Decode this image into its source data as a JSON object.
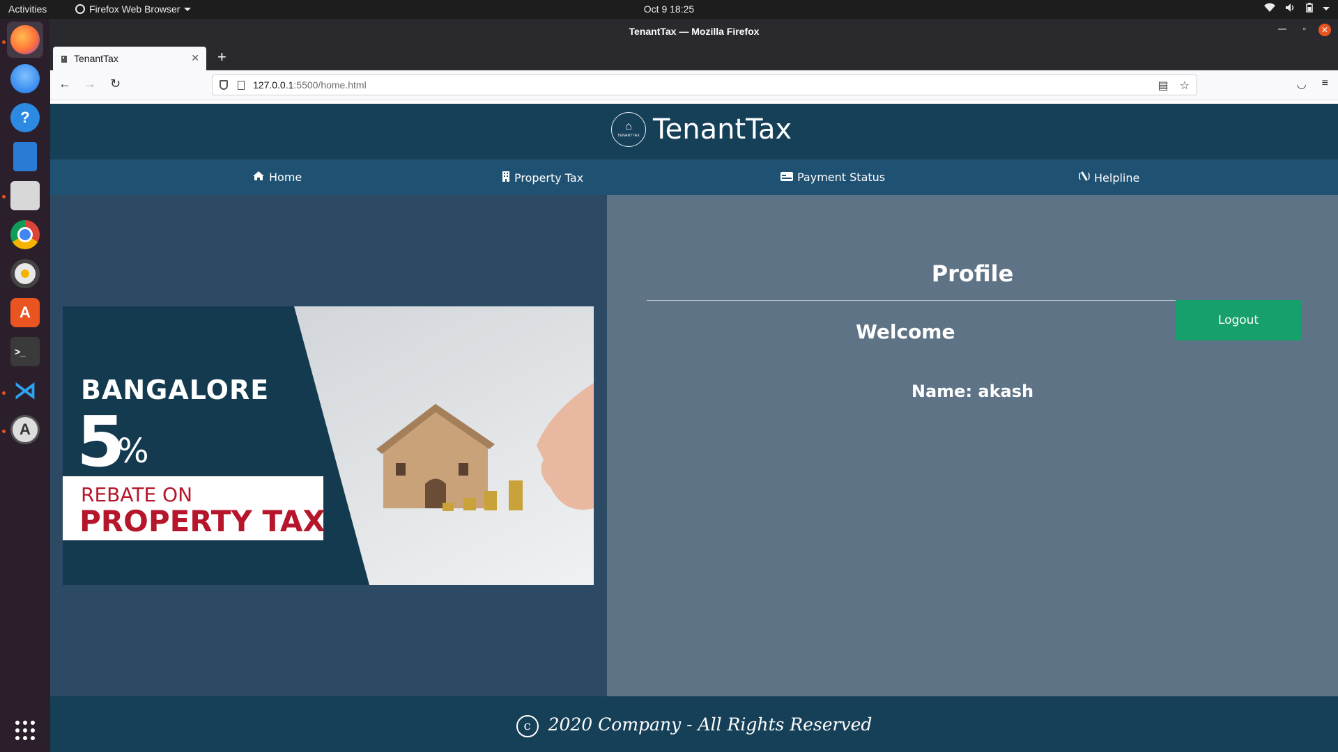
{
  "topbar": {
    "activities": "Activities",
    "app_menu": "Firefox Web Browser",
    "clock": "Oct 9  18:25"
  },
  "dock": {
    "apps": [
      "firefox-icon",
      "thunderbird-icon",
      "help-icon",
      "writer-icon",
      "files-icon",
      "chrome-icon",
      "rhythmbox-icon",
      "software-icon",
      "terminal-icon",
      "vscode-icon",
      "updater-icon"
    ]
  },
  "browser": {
    "window_title": "TenantTax — Mozilla Firefox",
    "tab_title": "TenantTax",
    "url_host": "127.0.0.1",
    "url_rest": ":5500/home.html"
  },
  "site": {
    "brand": "TenantTax",
    "logo_text": "TENANTTAX",
    "nav": [
      {
        "label": "Home",
        "icon": "home-icon"
      },
      {
        "label": "Property Tax",
        "icon": "building-icon"
      },
      {
        "label": "Payment Status",
        "icon": "card-icon"
      },
      {
        "label": "Helpline",
        "icon": "phone-icon"
      }
    ],
    "banner": {
      "city": "BANGALORE",
      "percent": "5",
      "percent_sign": "%",
      "rebate": "REBATE ON",
      "headline": "PROPERTY TAX"
    },
    "profile": {
      "title": "Profile",
      "logout": "Logout",
      "welcome": "Welcome",
      "name": "Name: akash"
    },
    "footer": {
      "copyright_symbol": "c",
      "text": "2020 Company - All Rights Reserved"
    }
  },
  "colors": {
    "header": "#163f58",
    "nav": "#1f5173",
    "left_pane": "#2c4a63",
    "right_pane": "#5e7385",
    "logout": "#18a06c"
  }
}
